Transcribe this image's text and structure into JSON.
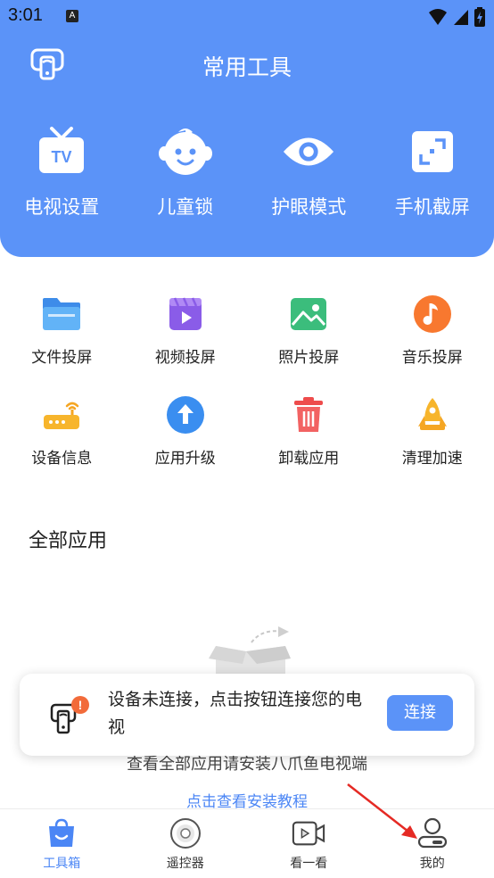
{
  "status_bar": {
    "time": "3:01",
    "notification_letter": "A"
  },
  "header": {
    "title": "常用工具",
    "tools": [
      {
        "label": "电视设置",
        "icon": "tv-icon"
      },
      {
        "label": "儿童锁",
        "icon": "child-face-icon"
      },
      {
        "label": "护眼模式",
        "icon": "eye-icon"
      },
      {
        "label": "手机截屏",
        "icon": "screenshot-icon"
      }
    ]
  },
  "grid": {
    "row1": [
      {
        "label": "文件投屏",
        "icon": "folder-icon"
      },
      {
        "label": "视频投屏",
        "icon": "video-clapper-icon"
      },
      {
        "label": "照片投屏",
        "icon": "photo-icon"
      },
      {
        "label": "音乐投屏",
        "icon": "music-note-icon"
      }
    ],
    "row2": [
      {
        "label": "设备信息",
        "icon": "router-icon"
      },
      {
        "label": "应用升级",
        "icon": "upgrade-arrow-icon"
      },
      {
        "label": "卸载应用",
        "icon": "trash-icon"
      },
      {
        "label": "清理加速",
        "icon": "rocket-icon"
      }
    ]
  },
  "all_apps": {
    "title": "全部应用",
    "empty_message": "查看全部应用请安装八爪鱼电视端",
    "tutorial_link": "点击查看安装教程"
  },
  "toast": {
    "message": "设备未连接，点击按钮连接您的电视",
    "badge": "!",
    "connect_button": "连接"
  },
  "bottom_nav": [
    {
      "label": "工具箱",
      "icon": "toolbox-bag-icon",
      "active": true
    },
    {
      "label": "遥控器",
      "icon": "remote-dial-icon",
      "active": false
    },
    {
      "label": "看一看",
      "icon": "video-camera-icon",
      "active": false
    },
    {
      "label": "我的",
      "icon": "profile-icon",
      "active": false
    }
  ],
  "colors": {
    "header_blue": "#5b93f8",
    "link_blue": "#4b86f5",
    "badge_orange": "#f26b3a",
    "annotation_red": "#e52a24"
  }
}
